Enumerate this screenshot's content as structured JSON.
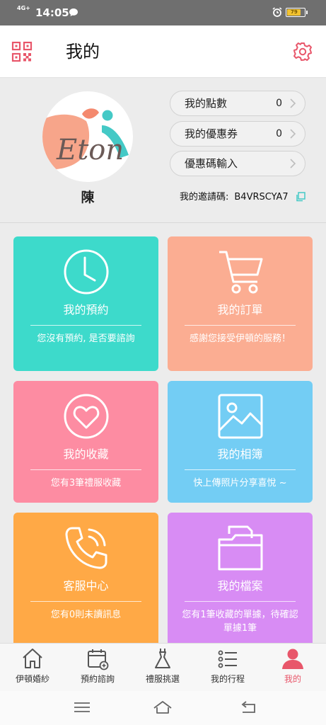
{
  "status_bar": {
    "network": "4G+",
    "time": "14:05",
    "battery": "79"
  },
  "header": {
    "title": "我的"
  },
  "profile": {
    "logo_text": "Eton",
    "name": "陳",
    "points_label": "我的點數",
    "points_value": "0",
    "coupons_label": "我的優惠券",
    "coupons_value": "0",
    "promo_label": "優惠碼輸入",
    "invite_label": "我的邀請碼:",
    "invite_code": "B4VRSCYA7"
  },
  "tiles": [
    {
      "title": "我的預約",
      "desc": "您沒有預約, 是否要諮詢",
      "color": "#3ddacb"
    },
    {
      "title": "我的訂單",
      "desc": "感謝您接受伊頓的服務！",
      "color": "#fbad92"
    },
    {
      "title": "我的收藏",
      "desc": "您有3筆禮服收藏",
      "color": "#fd8ca2"
    },
    {
      "title": "我的相簿",
      "desc": "快上傳照片分享喜悅 ~",
      "color": "#73cdf4"
    },
    {
      "title": "客服中心",
      "desc": "您有0則未讀訊息",
      "color": "#ffa946"
    },
    {
      "title": "我的檔案",
      "desc": "您有1筆收藏的單據，待確認單據1筆",
      "color": "#d88cf4"
    }
  ],
  "tabbar": {
    "items": [
      {
        "label": "伊頓婚紗",
        "icon": "home-icon"
      },
      {
        "label": "預約諮詢",
        "icon": "calendar-add-icon"
      },
      {
        "label": "禮服挑選",
        "icon": "dress-icon"
      },
      {
        "label": "我的行程",
        "icon": "list-icon"
      },
      {
        "label": "我的",
        "icon": "person-icon"
      }
    ],
    "active_index": 4,
    "active_color": "#e8566a"
  },
  "colors": {
    "accent": "#e8566a",
    "statusbar": "#6f6f6f"
  }
}
